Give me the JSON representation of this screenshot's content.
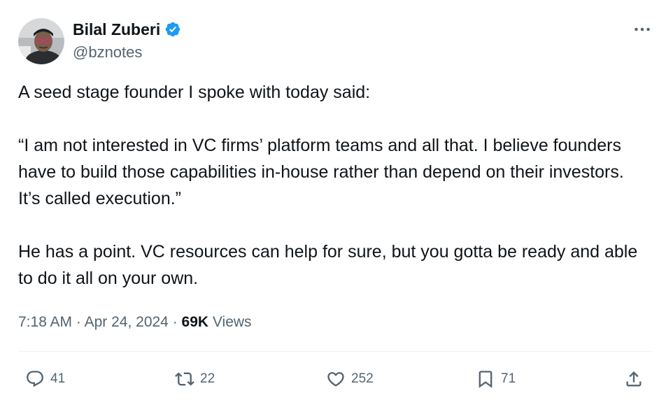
{
  "author": {
    "display_name": "Bilal Zuberi",
    "handle": "@bznotes",
    "verified": true,
    "avatar_icon": "profile-photo"
  },
  "post": {
    "paragraphs": [
      "A seed stage founder I spoke with today said:",
      "“I am not interested in VC firms’ platform teams and all that. I believe founders have to build those capabilities in-house rather than depend on their investors. It’s called execution.”",
      "He has a point. VC resources can help for sure, but you gotta be ready and able to do it all on your own."
    ]
  },
  "meta": {
    "time": "7:18 AM",
    "separator": "·",
    "date": "Apr 24, 2024",
    "views_count": "69K",
    "views_label": "Views"
  },
  "actions": {
    "reply_count": "41",
    "repost_count": "22",
    "like_count": "252",
    "bookmark_count": "71"
  },
  "colors": {
    "text_primary": "#0f1419",
    "text_secondary": "#536471",
    "verified_blue": "#1d9bf0",
    "divider": "#eff3f4"
  }
}
